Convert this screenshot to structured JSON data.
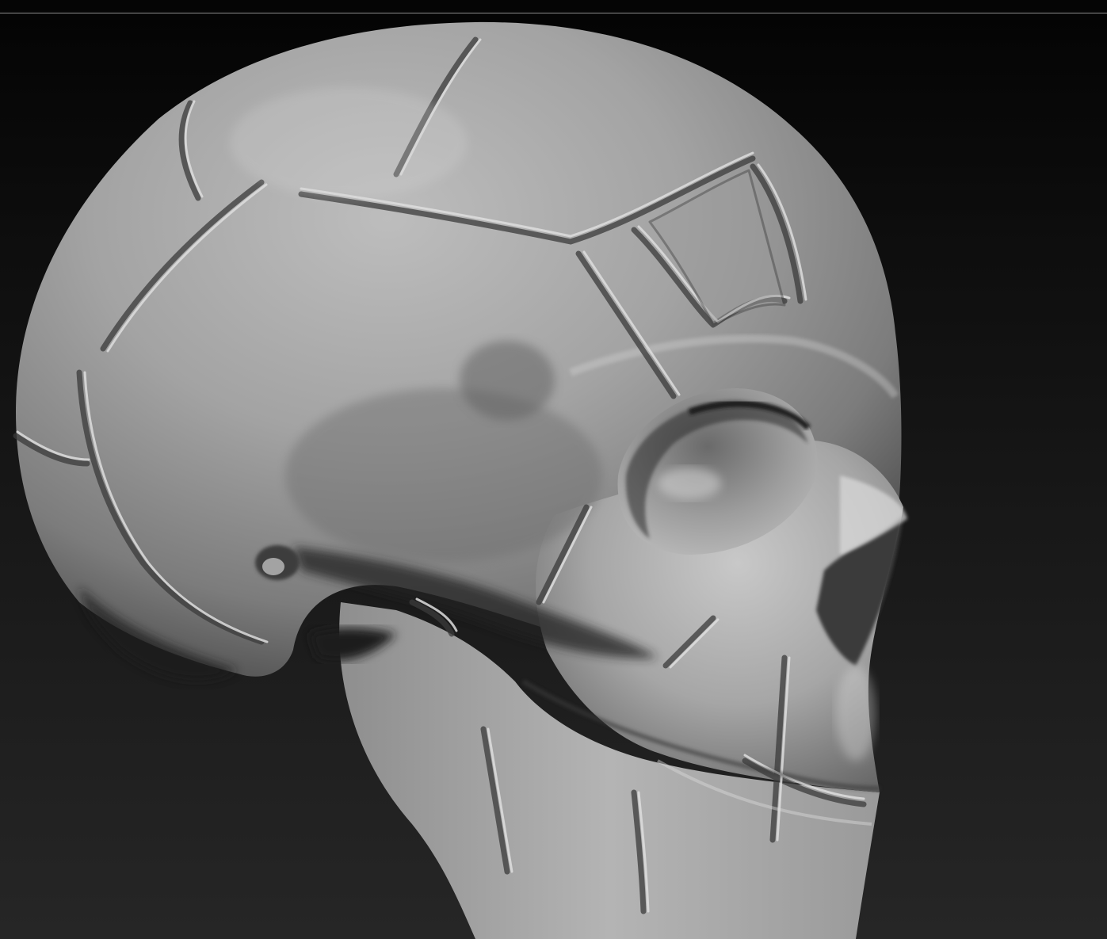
{
  "viewport": {
    "background_top": "#040404",
    "background_bottom": "#262626",
    "divider_color": "#8a8a8a"
  },
  "model": {
    "subject": "skull",
    "icon": "skull-icon",
    "material_color": "#8c8c8c",
    "highlight_color": "#cfcfcf",
    "shadow_color": "#1e1e1e"
  }
}
